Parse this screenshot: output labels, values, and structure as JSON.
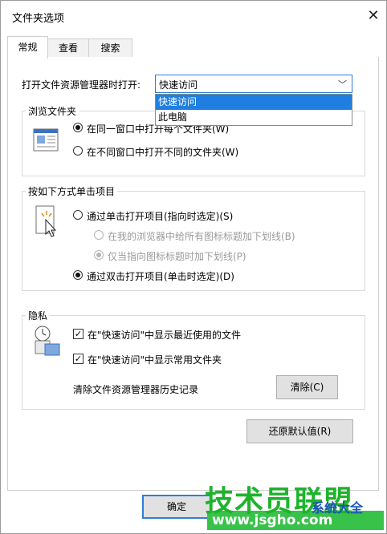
{
  "window": {
    "title": "文件夹选项",
    "close_glyph": "✕"
  },
  "tabs": [
    {
      "label": "常规",
      "active": true
    },
    {
      "label": "查看",
      "active": false
    },
    {
      "label": "搜索",
      "active": false
    }
  ],
  "open_explorer": {
    "label": "打开文件资源管理器时打开:",
    "selected": "快速访问",
    "options": [
      "快速访问",
      "此电脑"
    ]
  },
  "browse": {
    "title": "浏览文件夹",
    "options": [
      {
        "label": "在同一窗口中打开每个文件夹(W)",
        "checked": true
      },
      {
        "label": "在不同窗口中打开不同的文件夹(W)",
        "checked": false
      }
    ]
  },
  "click_items": {
    "title": "按如下方式单击项目",
    "single_click": "通过单击打开项目(指向时选定)(S)",
    "underline_all": "在我的浏览器中给所有图标标题加下划线(B)",
    "underline_hover": "仅当指向图标标题时加下划线(P)",
    "double_click": "通过双击打开项目(单击时选定)(D)"
  },
  "privacy": {
    "title": "隐私",
    "recent_files": "在\"快速访问\"中显示最近使用的文件",
    "frequent_folders": "在\"快速访问\"中显示常用文件夹",
    "clear_history_label": "清除文件资源管理器历史记录",
    "clear_button": "清除(C)"
  },
  "restore_defaults": "还原默认值(R)",
  "ok_button": "确定",
  "watermark": {
    "main": "技术员联盟",
    "sub": "www.jsgho.com",
    "side": "系统大全"
  }
}
